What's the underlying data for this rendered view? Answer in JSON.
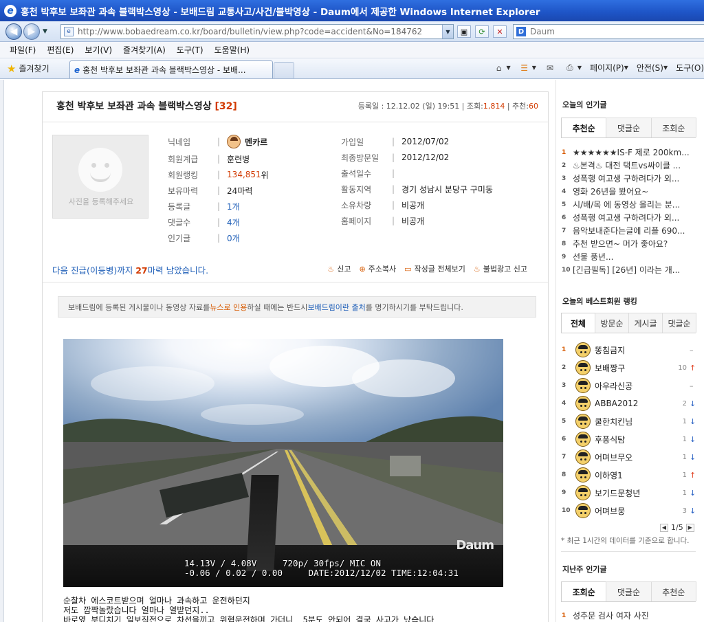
{
  "window": {
    "title": "홍천 박후보 보좌관 과속 블랙박스영상 - 보배드림 교통사고/사건/블박영상 - Daum에서 제공한 Windows Internet Explorer"
  },
  "address": {
    "url": "http://www.bobaedream.co.kr/board/bulletin/view.php?code=accident&No=184762",
    "search_placeholder": "Daum"
  },
  "menu": [
    "파일(F)",
    "편집(E)",
    "보기(V)",
    "즐겨찾기(A)",
    "도구(T)",
    "도움말(H)"
  ],
  "favbar": {
    "favorites_label": "즐겨찾기",
    "tab_title": "홍천 박후보 보좌관 과속 블랙박스영상 - 보배...",
    "page_label": "페이지(P)",
    "safety_label": "안전(S)",
    "tools_label": "도구(O)"
  },
  "article": {
    "title": "홍천 박후보 보좌관 과속 블랙박스영상",
    "comment_count": "[32]",
    "meta_prefix": "등록일 : 12.12.02 (일) 19:51 | 조회:",
    "views": "1,814",
    "meta_mid": " | 추천:",
    "recommends": "60"
  },
  "profile": {
    "photo_caption": "사진을 등록해주세요",
    "left": [
      {
        "k": "닉네임",
        "v": "멘카르",
        "style": "bold"
      },
      {
        "k": "회원계급",
        "v": "훈련병",
        "style": ""
      },
      {
        "k": "회원랭킹",
        "v": "134,851",
        "suffix": "위",
        "style": "red"
      },
      {
        "k": "보유마력",
        "v": "24마력",
        "style": ""
      },
      {
        "k": "등록글",
        "v": "1개",
        "style": "blue"
      },
      {
        "k": "댓글수",
        "v": "4개",
        "style": "blue"
      },
      {
        "k": "인기글",
        "v": "0개",
        "style": "blue"
      }
    ],
    "right": [
      {
        "k": "가입일",
        "v": "2012/07/02"
      },
      {
        "k": "최종방문일",
        "v": "2012/12/02"
      },
      {
        "k": "출석일수",
        "v": ""
      },
      {
        "k": "활동지역",
        "v": "경기 성남시 분당구 구미동"
      },
      {
        "k": "소유차량",
        "v": "비공개"
      },
      {
        "k": "홈페이지",
        "v": "비공개"
      }
    ]
  },
  "promo": {
    "before": "다음 진급(이등병)까지 ",
    "num": "27",
    "after": "마력 남았습니다."
  },
  "actions": [
    "신고",
    "주소복사",
    "작성글 전체보기",
    "불법광고 신고"
  ],
  "notice": {
    "p1": "보배드림에 등록된 게시물이나 동영상 자료를 ",
    "link1": "뉴스로 인용",
    "p2": "하실 때에는 반드시 ",
    "link2": "보배드림이란 출처",
    "p3": "를 명기하시기를 부탁드립니다."
  },
  "video": {
    "hud_line1": "14.13V / 4.08V     720p/ 30fps/ MIC ON",
    "hud_line2": "-0.06 / 0.02 / 0.00     DATE:2012/12/02 TIME:12:04:31",
    "logo": "Daum"
  },
  "body_text": [
    "순찰차 에스코트받으며 얼마나 과속하고 운전하던지",
    "저도 깜짝놀랐습니다 얼마나 열받던지..",
    "바로옆 부디치기 일보직전으로 차선을끼고 위협운전하며 가더니  5분도 안되어 결국 사고가 났습니다"
  ],
  "sidebar": {
    "popular_title": "오늘의 인기글",
    "popular_tabs": [
      "추천순",
      "댓글순",
      "조회순"
    ],
    "popular_items": [
      "★★★★★★IS-F 제로 200km...",
      "♨본격♨ 대전 택트vs싸이클 ...",
      "성폭행 여고생 구하려다가 외...",
      "영화 26년을 봤어요~",
      "시/배/목 에 동영상 올리는 분...",
      "성폭행 여고생 구하려다가 외...",
      "음악보내준다는글에 리플 690...",
      "추천 받으면~ 머가 좋아요?",
      "선물 풍년...",
      "[긴급필독] [26년] 이라는 개..."
    ],
    "best_title": "오늘의 베스트회원 랭킹",
    "best_tabs": [
      "전체",
      "방문순",
      "게시글",
      "댓글순"
    ],
    "best_items": [
      {
        "name": "똥침금지",
        "chg": "",
        "dir": "same"
      },
      {
        "name": "보배짱구",
        "chg": "10",
        "dir": "up"
      },
      {
        "name": "아우라신공",
        "chg": "",
        "dir": "same"
      },
      {
        "name": "ABBA2012",
        "chg": "2",
        "dir": "down"
      },
      {
        "name": "쿨한치킨님",
        "chg": "1",
        "dir": "down"
      },
      {
        "name": "후퐁식탐",
        "chg": "1",
        "dir": "down"
      },
      {
        "name": "어며브무오",
        "chg": "1",
        "dir": "down"
      },
      {
        "name": "이하영1",
        "chg": "1",
        "dir": "up"
      },
      {
        "name": "보기드문청년",
        "chg": "1",
        "dir": "down"
      },
      {
        "name": "어며브뭉",
        "chg": "3",
        "dir": "down"
      }
    ],
    "pager": "1/5",
    "pager_note": "* 최근 1시간의 데이터를 기준으로 합니다.",
    "lastweek_title": "지난주 인기글",
    "lastweek_tabs": [
      "조회순",
      "댓글순",
      "추천순"
    ],
    "lastweek_items": [
      "성추문 검사 여자 사진"
    ]
  }
}
